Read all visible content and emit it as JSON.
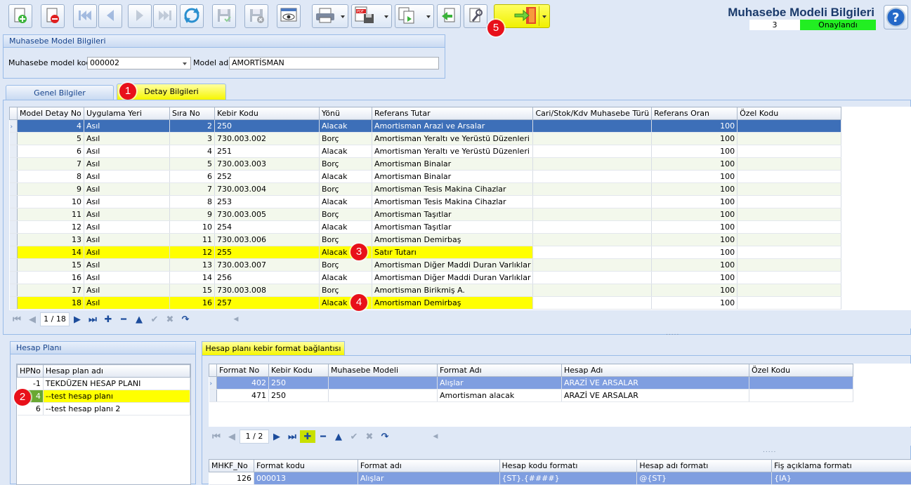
{
  "header": {
    "title": "Muhasebe Modeli Bilgileri",
    "record_no": "3",
    "status": "Onaylandı"
  },
  "toolbar": {
    "buttons": [
      "new-doc-icon",
      "delete-doc-icon",
      "first-record-icon",
      "prev-record-icon",
      "next-record-icon",
      "last-record-icon",
      "refresh-icon",
      "save-icon",
      "save-close-icon",
      "preview-icon",
      "print-icon",
      "pdf-export-icon",
      "copy-icon",
      "back-arrow-icon",
      "tools-icon",
      "exit-door-icon"
    ]
  },
  "model_group": {
    "title": "Muhasebe Model Bilgileri",
    "code_label": "Muhasebe model kodu",
    "code_value": "000002",
    "name_label": "Model adı",
    "name_value": "AMORTİSMAN"
  },
  "tabs": {
    "general": "Genel Bilgiler",
    "detail": "Detay Bilgileri"
  },
  "detail_grid": {
    "columns": [
      "Model Detay No",
      "Uygulama Yeri",
      "Sıra No",
      "Kebir Kodu",
      "Yönü",
      "Referans Tutar",
      "Cari/Stok/Kdv Muhasebe Türü",
      "Referans Oran",
      "Özel Kodu"
    ],
    "rows": [
      {
        "no": "4",
        "yer": "Asıl",
        "sira": "2",
        "kebir": "250",
        "yon": "Alacak",
        "ref": "Amortisman Arazi ve Arsalar",
        "tur": "",
        "oran": "100",
        "ozel": ""
      },
      {
        "no": "5",
        "yer": "Asıl",
        "sira": "3",
        "kebir": "730.003.002",
        "yon": "Borç",
        "ref": "Amortisman Yeraltı ve Yerüstü Düzenleri",
        "tur": "",
        "oran": "100",
        "ozel": ""
      },
      {
        "no": "6",
        "yer": "Asıl",
        "sira": "4",
        "kebir": "251",
        "yon": "Alacak",
        "ref": "Amortisman Yeraltı ve Yerüstü Düzenleri",
        "tur": "",
        "oran": "100",
        "ozel": ""
      },
      {
        "no": "7",
        "yer": "Asıl",
        "sira": "5",
        "kebir": "730.003.003",
        "yon": "Borç",
        "ref": "Amortisman Binalar",
        "tur": "",
        "oran": "100",
        "ozel": ""
      },
      {
        "no": "8",
        "yer": "Asıl",
        "sira": "6",
        "kebir": "252",
        "yon": "Alacak",
        "ref": "Amortisman Binalar",
        "tur": "",
        "oran": "100",
        "ozel": ""
      },
      {
        "no": "9",
        "yer": "Asıl",
        "sira": "7",
        "kebir": "730.003.004",
        "yon": "Borç",
        "ref": "Amortisman Tesis Makina Cihazlar",
        "tur": "",
        "oran": "100",
        "ozel": ""
      },
      {
        "no": "10",
        "yer": "Asıl",
        "sira": "8",
        "kebir": "253",
        "yon": "Alacak",
        "ref": "Amortisman Tesis Makina Cihazlar",
        "tur": "",
        "oran": "100",
        "ozel": ""
      },
      {
        "no": "11",
        "yer": "Asıl",
        "sira": "9",
        "kebir": "730.003.005",
        "yon": "Borç",
        "ref": "Amortisman Taşıtlar",
        "tur": "",
        "oran": "100",
        "ozel": ""
      },
      {
        "no": "12",
        "yer": "Asıl",
        "sira": "10",
        "kebir": "254",
        "yon": "Alacak",
        "ref": "Amortisman Taşıtlar",
        "tur": "",
        "oran": "100",
        "ozel": ""
      },
      {
        "no": "13",
        "yer": "Asıl",
        "sira": "11",
        "kebir": "730.003.006",
        "yon": "Borç",
        "ref": "Amortisman Demirbaş",
        "tur": "",
        "oran": "100",
        "ozel": ""
      },
      {
        "no": "14",
        "yer": "Asıl",
        "sira": "12",
        "kebir": "255",
        "yon": "Alacak",
        "ref": "Satır Tutarı",
        "tur": "",
        "oran": "100",
        "ozel": ""
      },
      {
        "no": "15",
        "yer": "Asıl",
        "sira": "13",
        "kebir": "730.003.007",
        "yon": "Borç",
        "ref": "Amortisman Diğer Maddi Duran Varlıklar",
        "tur": "",
        "oran": "100",
        "ozel": ""
      },
      {
        "no": "16",
        "yer": "Asıl",
        "sira": "14",
        "kebir": "256",
        "yon": "Alacak",
        "ref": "Amortisman Diğer Maddi Duran Varlıklar",
        "tur": "",
        "oran": "100",
        "ozel": ""
      },
      {
        "no": "17",
        "yer": "Asıl",
        "sira": "15",
        "kebir": "730.003.008",
        "yon": "Borç",
        "ref": "Amortisman Birikmiş A.",
        "tur": "",
        "oran": "100",
        "ozel": ""
      },
      {
        "no": "18",
        "yer": "Asıl",
        "sira": "16",
        "kebir": "257",
        "yon": "Alacak",
        "ref": "Amortisman Demirbaş",
        "tur": "",
        "oran": "100",
        "ozel": ""
      }
    ],
    "pager": "1 / 18"
  },
  "account_plan": {
    "title": "Hesap Planı",
    "columns": [
      "HPNo",
      "Hesap plan adı"
    ],
    "rows": [
      {
        "no": "-1",
        "name": "TEKDÜZEN HESAP PLANI"
      },
      {
        "no": "4",
        "name": "--test hesap planı"
      },
      {
        "no": "6",
        "name": "--test hesap planı 2"
      }
    ]
  },
  "format_link": {
    "title": "Hesap planı kebir format bağlantısı",
    "columns": [
      "Format No",
      "Kebir Kodu",
      "Muhasebe Modeli",
      "Format Adı",
      "Hesap Adı",
      "Özel Kodu"
    ],
    "rows": [
      {
        "no": "402",
        "kebir": "250",
        "model": "",
        "format": "Alışlar",
        "hesap": "ARAZİ VE ARSALAR",
        "ozel": ""
      },
      {
        "no": "471",
        "kebir": "250",
        "model": "",
        "format": "Amortisman alacak",
        "hesap": "ARAZİ VE ARSALAR",
        "ozel": ""
      }
    ],
    "pager": "1 / 2"
  },
  "mhkf_grid": {
    "columns": [
      "MHKF_No",
      "Format kodu",
      "Format adı",
      "Hesap kodu formatı",
      "Hesap adı formatı",
      "Fiş açıklama formatı"
    ],
    "rows": [
      {
        "no": "126",
        "kod": "000013",
        "ad": "Alışlar",
        "hkf": "{ST}.{####}",
        "haf": "@{ST}",
        "fis": "{IA}"
      }
    ]
  },
  "annotations": [
    "1",
    "2",
    "3",
    "4",
    "5"
  ],
  "colors": {
    "highlight": "#ffff00",
    "selection": "#3d6fb8",
    "status_ok": "#22ee22",
    "badge": "#e8101a"
  }
}
